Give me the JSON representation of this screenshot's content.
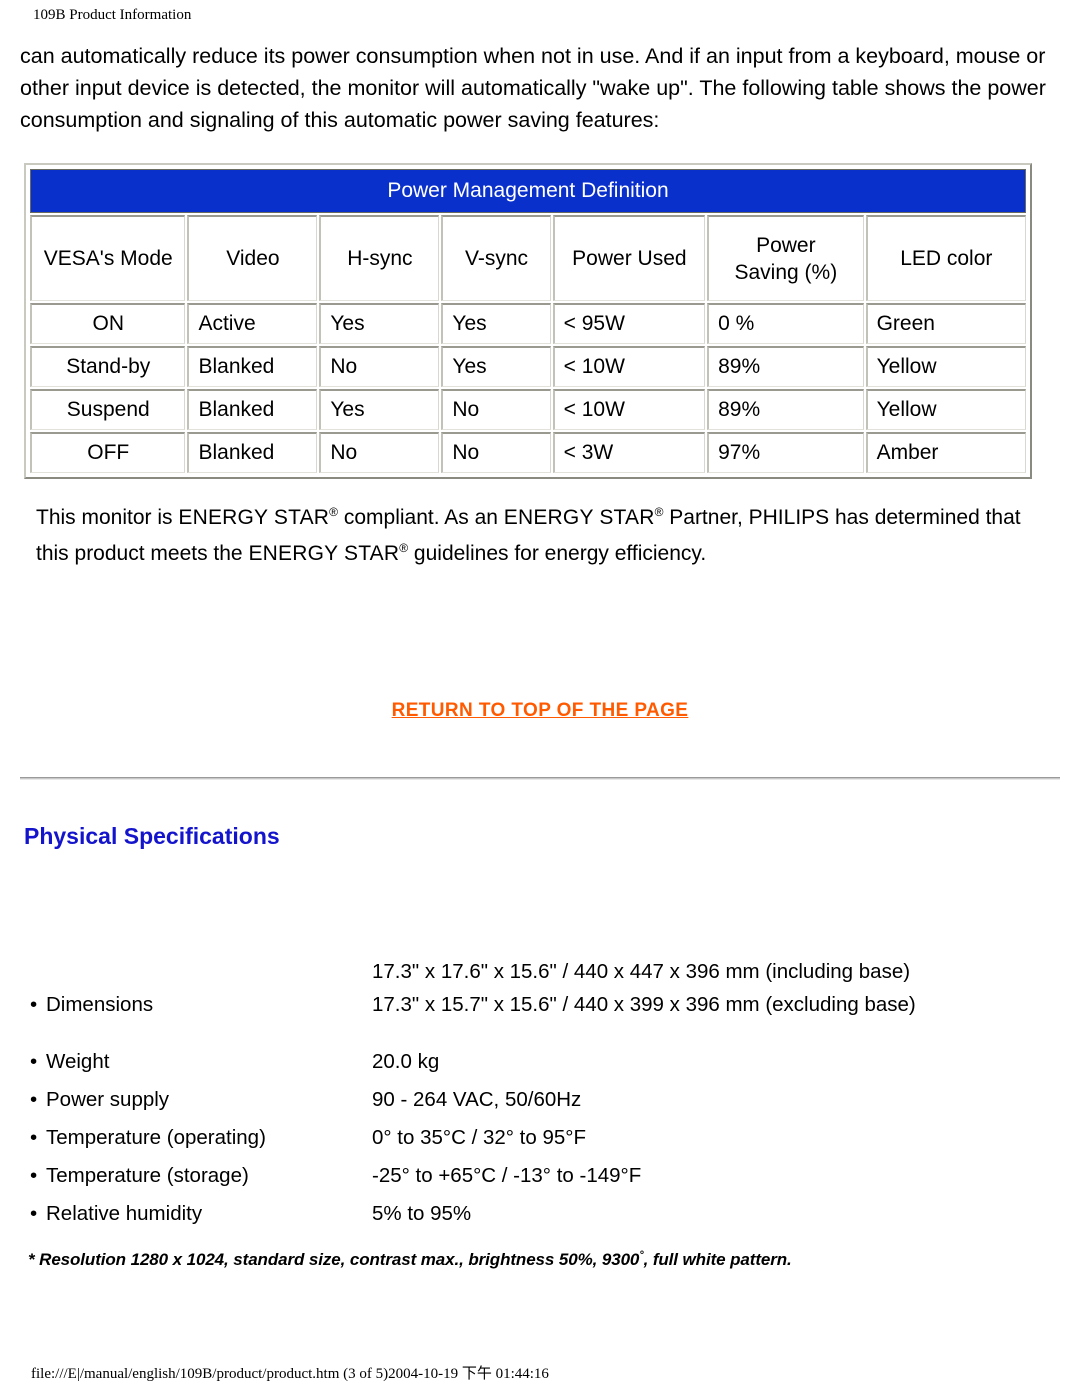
{
  "page_header": "109B Product Information",
  "intro_paragraph": "can automatically reduce its power consumption when not in use. And if an input from a keyboard, mouse or other input device is detected, the monitor will automatically \"wake up\". The following table shows the power consumption and signaling of this automatic power saving features:",
  "power_table": {
    "title": "Power Management Definition",
    "headers": [
      "VESA's Mode",
      "Video",
      "H-sync",
      "V-sync",
      "Power Used",
      "Power\nSaving (%)",
      "LED color"
    ],
    "header_power_saving_line1": "Power",
    "header_power_saving_line2": "Saving (%)",
    "rows": [
      [
        "ON",
        "Active",
        "Yes",
        "Yes",
        "< 95W",
        "0 %",
        "Green"
      ],
      [
        "Stand-by",
        "Blanked",
        "No",
        "Yes",
        "< 10W",
        "89%",
        "Yellow"
      ],
      [
        "Suspend",
        "Blanked",
        "Yes",
        "No",
        "< 10W",
        "89%",
        "Yellow"
      ],
      [
        "OFF",
        "Blanked",
        "No",
        "No",
        "< 3W",
        "97%",
        "Amber"
      ]
    ],
    "header_bg_color": "#0a30cc",
    "header_text_color": "#ffffff"
  },
  "energy_star": {
    "part1": "This monitor is ",
    "brand1": "ENERGY STAR",
    "part2": " compliant. As an ",
    "brand2": "ENERGY STAR",
    "part3": " Partner, PHILIPS has determined that this product meets the ",
    "brand3": "ENERGY STAR",
    "part4": " guidelines for energy efficiency.",
    "reg_mark": "®"
  },
  "return_link": {
    "label": "RETURN TO TOP OF THE PAGE",
    "color": "#ff5a00"
  },
  "section_title": "Physical Specifications",
  "section_title_color": "#1414cc",
  "specs": [
    {
      "label": "Dimensions",
      "value": "17.3\" x 17.6\" x 15.6\" / 440 x 447 x 396 mm (including base)\n17.3\" x 15.7\" x 15.6\" / 440 x 399 x 396 mm (excluding base)"
    },
    {
      "label": "Weight",
      "value": "20.0 kg"
    },
    {
      "label": "Power supply",
      "value": "90 - 264 VAC, 50/60Hz"
    },
    {
      "label": "Temperature (operating)",
      "value": "0° to 35°C / 32° to 95°F"
    },
    {
      "label": "Temperature (storage)",
      "value": "-25° to +65°C / -13° to -149°F"
    },
    {
      "label": "Relative humidity",
      "value": "5% to 95%"
    }
  ],
  "footnote": {
    "before_degree": "* Resolution 1280 x 1024, standard size, contrast max., brightness 50%, 9300",
    "degree": "°",
    "after_degree": ", full white pattern."
  },
  "footer_path": "file:///E|/manual/english/109B/product/product.htm (3 of 5)2004-10-19 下午 01:44:16",
  "bullet_glyph": "•"
}
